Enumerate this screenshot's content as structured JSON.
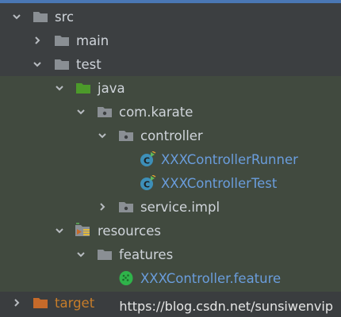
{
  "tree": {
    "items": [
      {
        "label": "src",
        "expanded": true,
        "icon": "folder-icon"
      },
      {
        "label": "main",
        "expanded": false,
        "icon": "folder-icon"
      },
      {
        "label": "test",
        "expanded": true,
        "icon": "folder-icon"
      },
      {
        "label": "java",
        "expanded": true,
        "icon": "test-source-folder-icon"
      },
      {
        "label": "com.karate",
        "expanded": true,
        "icon": "package-icon"
      },
      {
        "label": "controller",
        "expanded": true,
        "icon": "package-icon"
      },
      {
        "label": "XXXControllerRunner",
        "icon": "test-class-icon"
      },
      {
        "label": "XXXControllerTest",
        "icon": "test-class-icon"
      },
      {
        "label": "service.impl",
        "expanded": false,
        "icon": "package-icon"
      },
      {
        "label": "resources",
        "expanded": true,
        "icon": "test-resources-folder-icon"
      },
      {
        "label": "features",
        "expanded": true,
        "icon": "folder-icon"
      },
      {
        "label": "XXXController.feature",
        "icon": "cucumber-feature-icon"
      },
      {
        "label": "target",
        "expanded": false,
        "icon": "excluded-folder-icon"
      }
    ]
  },
  "watermark": "https://blog.csdn.net/sunsiwenvip",
  "colors": {
    "background": "#3c3f41",
    "highlight": "#414a3f",
    "text": "#cfd4da",
    "test_class_text": "#6a9ddc",
    "excluded_text": "#c77d2a",
    "folder": "#8a8f94",
    "test_folder": "#4c9a2a",
    "excluded_folder": "#c66a2a",
    "class_icon_bg": "#3d8fb8",
    "cucumber": "#2fb34a"
  }
}
